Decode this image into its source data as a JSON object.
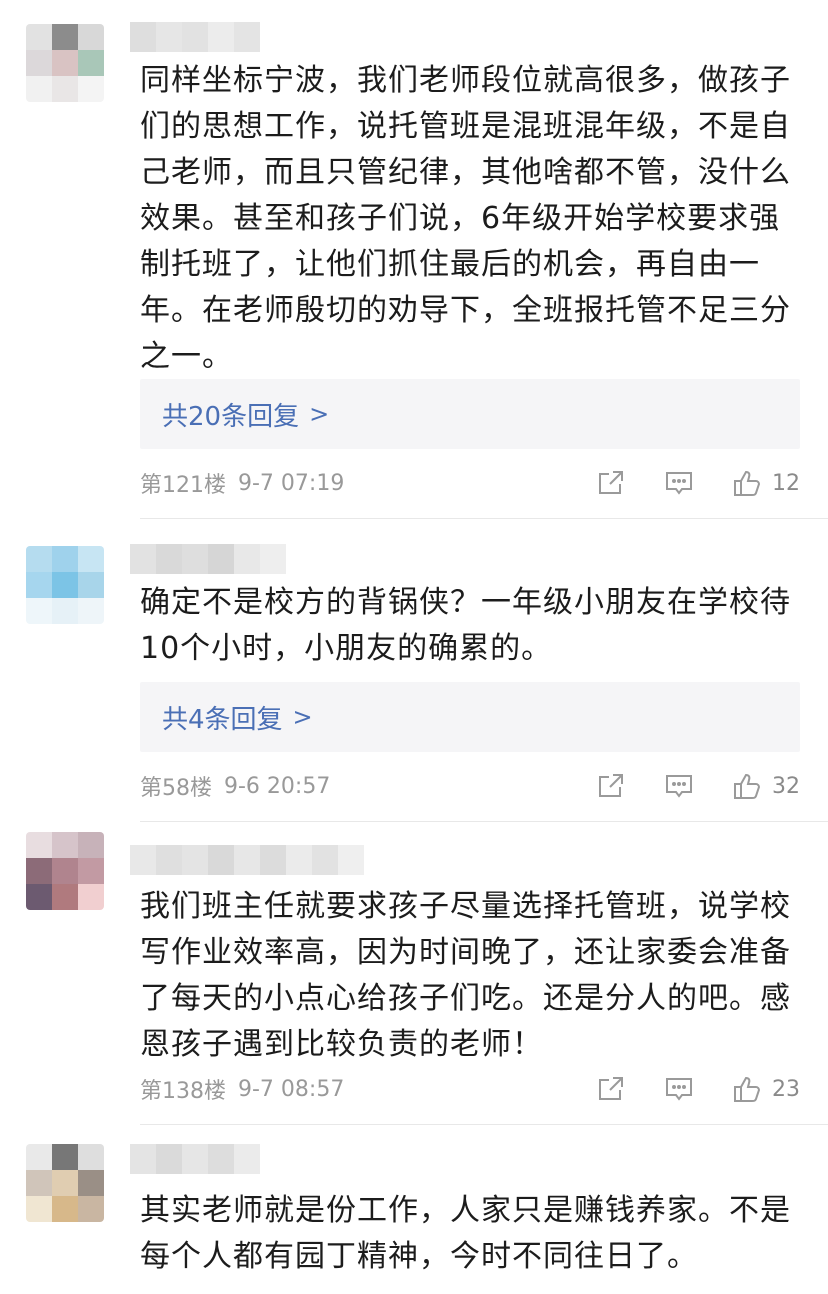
{
  "comments": [
    {
      "text": "同样坐标宁波，我们老师段位就高很多，做孩子们的思想工作，说托管班是混班混年级，不是自己老师，而且只管纪律，其他啥都不管，没什么效果。甚至和孩子们说，6年级开始学校要求强制托班了，让他们抓住最后的机会，再自由一年。在老师殷切的劝导下，全班报托管不足三分之一。",
      "replies_label": "共20条回复",
      "floor": "第121楼",
      "time": "9-7 07:19",
      "likes": "12",
      "avatar_colors": [
        "#e2e2e2",
        "#8c8c8c",
        "#d8d8d8",
        "#dcd8da",
        "#d9c3c3",
        "#a9c7b8",
        "#f1f1f1",
        "#e9e6e6",
        "#f4f4f4"
      ],
      "name_colors": [
        "#dedede",
        "#e6e6e6",
        "#e2e2e2",
        "#ececec",
        "#e4e4e4"
      ]
    },
    {
      "text": "确定不是校方的背锅侠？一年级小朋友在学校待10个小时，小朋友的确累的。",
      "replies_label": "共4条回复",
      "floor": "第58楼",
      "time": "9-6 20:57",
      "likes": "32",
      "avatar_colors": [
        "#b5dcef",
        "#9fd2ec",
        "#c7e5f3",
        "#a6d6ee",
        "#7cc4e6",
        "#a8d5ea",
        "#eef6fa",
        "#e6f1f7",
        "#eef5f9"
      ],
      "name_colors": [
        "#e2e2e2",
        "#d9d9d9",
        "#dedede",
        "#d6d6d6",
        "#e8e8e8",
        "#eeeeee"
      ]
    },
    {
      "text": "我们班主任就要求孩子尽量选择托管班，说学校写作业效率高，因为时间晚了，还让家委会准备了每天的小点心给孩子们吃。还是分人的吧。感恩孩子遇到比较负责的老师！",
      "floor": "第138楼",
      "time": "9-7 08:57",
      "likes": "23",
      "avatar_colors": [
        "#e8dde0",
        "#d6c4ca",
        "#c7b2b9",
        "#8c6b78",
        "#b0848e",
        "#c29aa3",
        "#6c5a70",
        "#b07a7e",
        "#f1cfd0"
      ],
      "name_colors": [
        "#e8e8e8",
        "#dfdfdf",
        "#e4e4e4",
        "#d9d9d9",
        "#e7e7e7",
        "#dcdcdc",
        "#ebebeb",
        "#e2e2e2",
        "#efefef"
      ]
    },
    {
      "text": "其实老师就是份工作，人家只是赚钱养家。不是每个人都有园丁精神，今时不同往日了。",
      "avatar_colors": [
        "#e9e9e9",
        "#777777",
        "#dedede",
        "#d0c5ba",
        "#e0cdb1",
        "#9a8f86",
        "#f0e6d2",
        "#d7b88a",
        "#c9b6a2"
      ],
      "name_colors": [
        "#e4e4e4",
        "#dadada",
        "#e6e6e6",
        "#dddddd",
        "#ebebeb"
      ]
    }
  ]
}
